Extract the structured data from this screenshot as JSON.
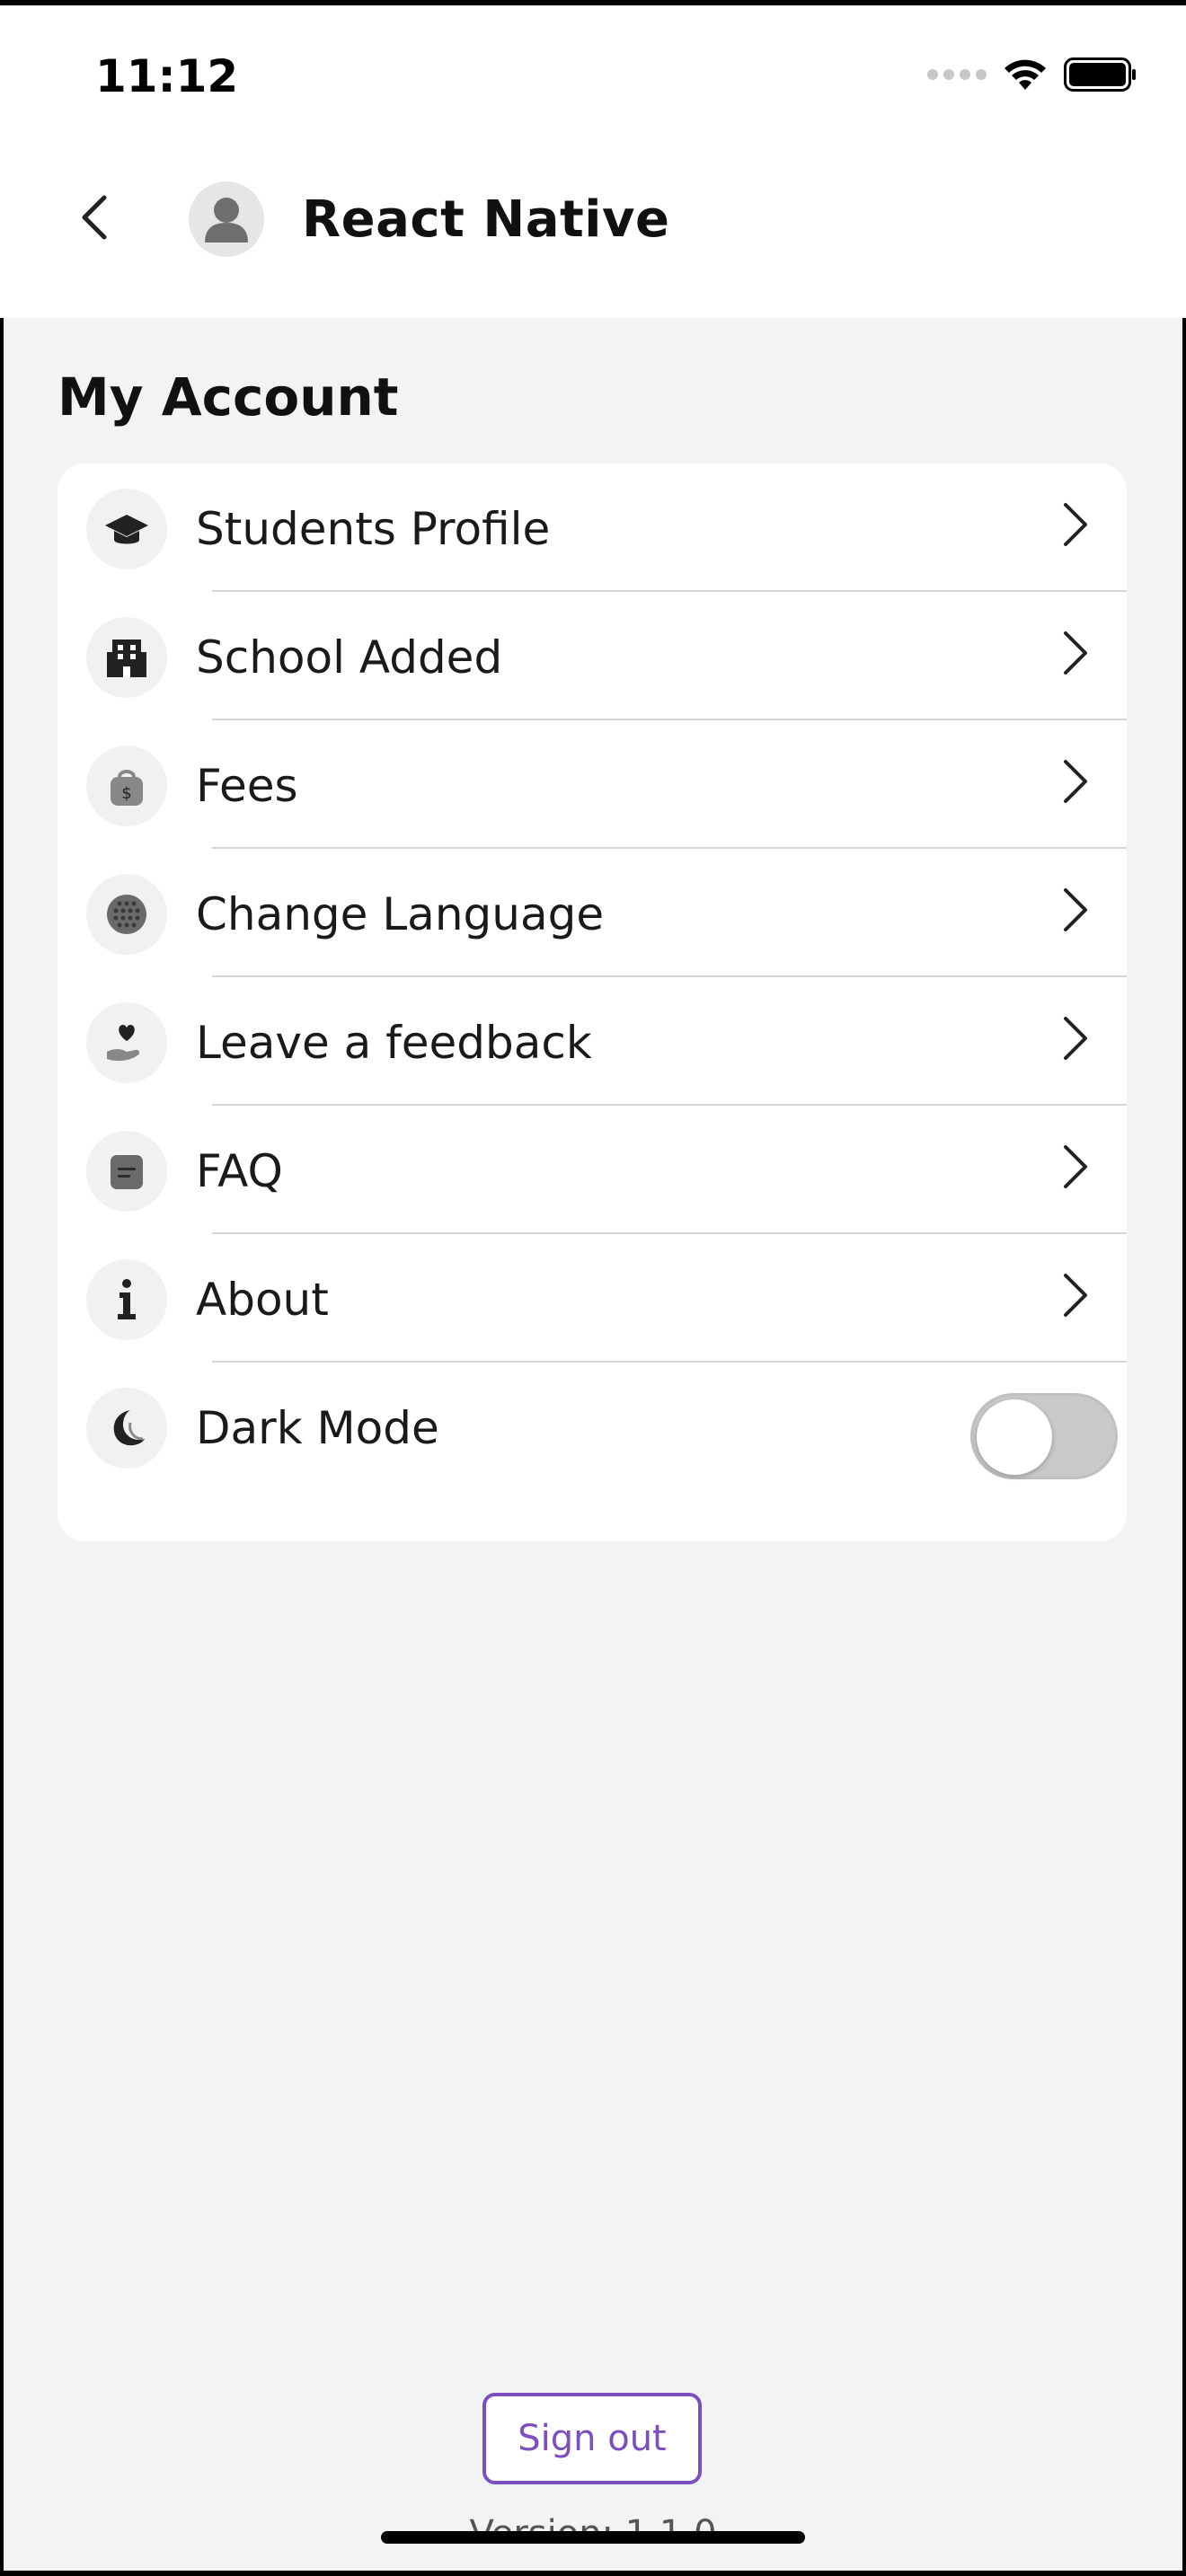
{
  "status_bar": {
    "time": "11:12"
  },
  "nav": {
    "title": "React Native"
  },
  "section": {
    "title": "My Account"
  },
  "menu": [
    {
      "label": "Students Profile",
      "icon": "graduation-cap-icon"
    },
    {
      "label": "School Added",
      "icon": "building-icon"
    },
    {
      "label": "Fees",
      "icon": "money-bag-icon"
    },
    {
      "label": "Change Language",
      "icon": "globe-icon"
    },
    {
      "label": "Leave a feedback",
      "icon": "hand-heart-icon"
    },
    {
      "label": "FAQ",
      "icon": "note-icon"
    },
    {
      "label": "About",
      "icon": "info-icon"
    },
    {
      "label": "Dark Mode",
      "icon": "moon-icon",
      "toggle": false
    }
  ],
  "footer": {
    "signout_label": "Sign out",
    "version": "Version: 1.1.0"
  },
  "colors": {
    "accent": "#7b4fc0",
    "background": "#f2f3f5",
    "card": "#ffffff"
  }
}
